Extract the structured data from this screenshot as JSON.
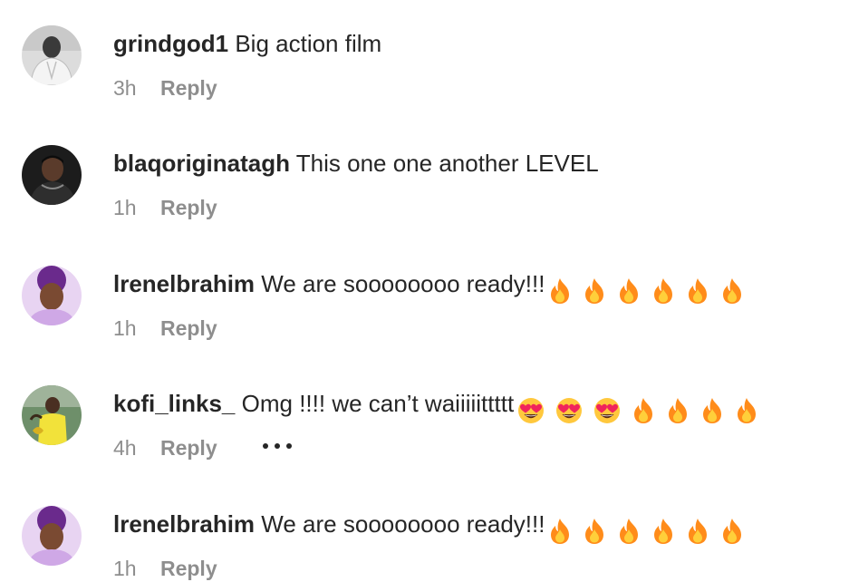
{
  "colors": {
    "text_primary": "#262626",
    "text_secondary": "#8e8e8e",
    "fire_outer": "#ff8c1a",
    "fire_inner": "#ffcf3a",
    "heart_eyes_face": "#ffc83d",
    "heart_eyes_hearts": "#f0245c"
  },
  "comments": [
    {
      "username": "grindgod1",
      "text": "Big action film",
      "emojis": [],
      "timestamp": "3h",
      "reply_label": "Reply",
      "has_more_button": false,
      "avatar_icon": "avatar-person-white-hoodie"
    },
    {
      "username": "blaqoriginatagh",
      "text": "This one one another LEVEL",
      "emojis": [],
      "timestamp": "1h",
      "reply_label": "Reply",
      "has_more_button": false,
      "avatar_icon": "avatar-person-dark-portrait"
    },
    {
      "username": "lrenelbrahim",
      "text": "We are soooooooo ready!!!",
      "emojis": [
        "fire-icon",
        "fire-icon",
        "fire-icon",
        "fire-icon",
        "fire-icon",
        "fire-icon"
      ],
      "timestamp": "1h",
      "reply_label": "Reply",
      "has_more_button": false,
      "avatar_icon": "avatar-person-purple-hair"
    },
    {
      "username": "kofi_links_",
      "text": "Omg !!!! we can’t waiiiiittttt",
      "emojis": [
        "heart-eyes-icon",
        "heart-eyes-icon",
        "heart-eyes-icon",
        "fire-icon",
        "fire-icon",
        "fire-icon",
        "fire-icon"
      ],
      "timestamp": "4h",
      "reply_label": "Reply",
      "has_more_button": true,
      "avatar_icon": "avatar-person-yellow-shirt"
    },
    {
      "username": "lrenelbrahim",
      "text": "We are soooooooo ready!!!",
      "emojis": [
        "fire-icon",
        "fire-icon",
        "fire-icon",
        "fire-icon",
        "fire-icon",
        "fire-icon"
      ],
      "timestamp": "1h",
      "reply_label": "Reply",
      "has_more_button": false,
      "avatar_icon": "avatar-person-purple-hair"
    }
  ]
}
